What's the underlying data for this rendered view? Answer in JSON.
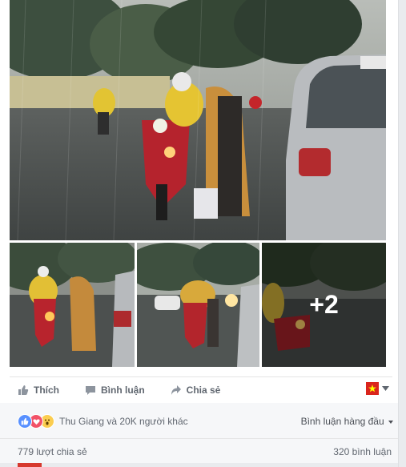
{
  "post": {
    "photos": [
      {
        "name": "main-photo",
        "alt": ""
      },
      {
        "name": "thumb-1",
        "alt": ""
      },
      {
        "name": "thumb-2",
        "alt": ""
      },
      {
        "name": "thumb-3",
        "alt": "",
        "more_count": "+2"
      }
    ]
  },
  "actions": {
    "like_label": "Thích",
    "comment_label": "Bình luận",
    "share_label": "Chia sẻ"
  },
  "reactions": {
    "icons": [
      "like-icon",
      "love-icon",
      "wow-icon"
    ],
    "summary": "Thu Giang và 20K người khác",
    "sort_label": "Bình luận hàng đầu"
  },
  "counts": {
    "shares": "779 lượt chia sẻ",
    "comments": "320 bình luận"
  },
  "colors": {
    "like_blue": "#5890ff",
    "love_red": "#f25268",
    "wow_yellow": "#fbcd50",
    "flag_red": "#da251d",
    "flag_star": "#ffff00"
  }
}
